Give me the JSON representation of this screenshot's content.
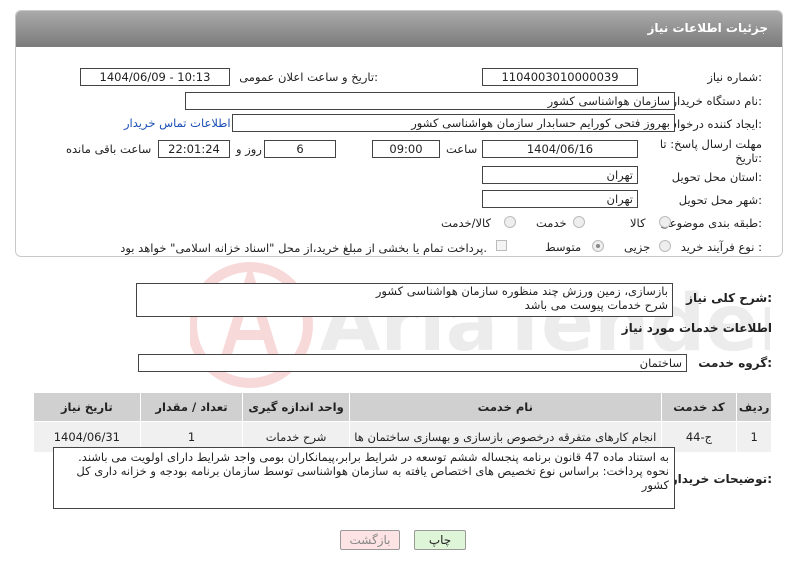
{
  "header": {
    "title": "جزئیات اطلاعات نیاز"
  },
  "fields": {
    "need_number_label": "شماره نیاز:",
    "need_number": "1104003010000039",
    "announce_label": "تاریخ و ساعت اعلان عمومی:",
    "announce_value": "1404/06/09 - 10:13",
    "buyer_org_label": "نام دستگاه خریدار:",
    "buyer_org": "سازمان هواشناسی کشور",
    "creator_label": "ایجاد کننده درخواست:",
    "creator": "بهروز فتحی کورایم حسابدار سازمان هواشناسی کشور",
    "contact_link": "اطلاعات تماس خریدار",
    "deadline_label": "مهلت ارسال پاسخ: تا تاریخ:",
    "deadline_date": "1404/06/16",
    "time_label": "ساعت",
    "deadline_time": "09:00",
    "days_value": "6",
    "days_label": "روز و",
    "remaining_time": "22:01:24",
    "remaining_label": "ساعت باقی مانده",
    "province_label": "استان محل تحویل:",
    "province": "تهران",
    "city_label": "شهر محل تحویل:",
    "city": "تهران",
    "category_label": "طبقه بندی موضوعی:",
    "category_options": [
      "کالا",
      "خدمت",
      "کالا/خدمت"
    ],
    "process_label": "نوع فرآیند خرید :",
    "process_options": [
      "جزیی",
      "متوسط"
    ],
    "payment_note": "پرداخت تمام یا بخشی از مبلغ خرید،از محل \"اسناد خزانه اسلامی\" خواهد بود."
  },
  "summary": {
    "label": "شرح کلی نیاز:",
    "line1": "بازسازی، زمین ورزش چند منظوره سازمان هواشناسی کشور",
    "line2": "شرح خدمات پیوست می باشد"
  },
  "services_section": {
    "title": "اطلاعات خدمات مورد نیاز",
    "group_label": "گروه خدمت:",
    "group_value": "ساختمان"
  },
  "table": {
    "headers": [
      "ردیف",
      "کد خدمت",
      "نام خدمت",
      "واحد اندازه گیری",
      "تعداد / مقدار",
      "تاریخ نیاز"
    ],
    "rows": [
      [
        "1",
        "ج-44",
        "انجام کارهای متفرقه درخصوص بازسازی و بهسازی ساختمان ها",
        "شرح خدمات",
        "1",
        "1404/06/31"
      ]
    ]
  },
  "buyer_notes": {
    "label": "توضیحات خریدار:",
    "text": "به استناد ماده 47 قانون برنامه پنجساله ششم توسعه در شرایط برابر،پیمانکاران بومی واجد شرایط دارای اولویت می باشند. نحوه پرداخت: براساس نوع تخصیص های اختصاص یافته به سازمان هواشناسی توسط سازمان برنامه بودجه و خزانه داری کل کشور"
  },
  "buttons": {
    "print": "چاپ",
    "back": "بازگشت"
  },
  "watermark_text": "AriaTender.neT",
  "colors": {
    "header": "#8a8a8a",
    "link": "#1a4fb5",
    "print_btn": "#dff5d8",
    "back_btn": "#fde3e3"
  }
}
